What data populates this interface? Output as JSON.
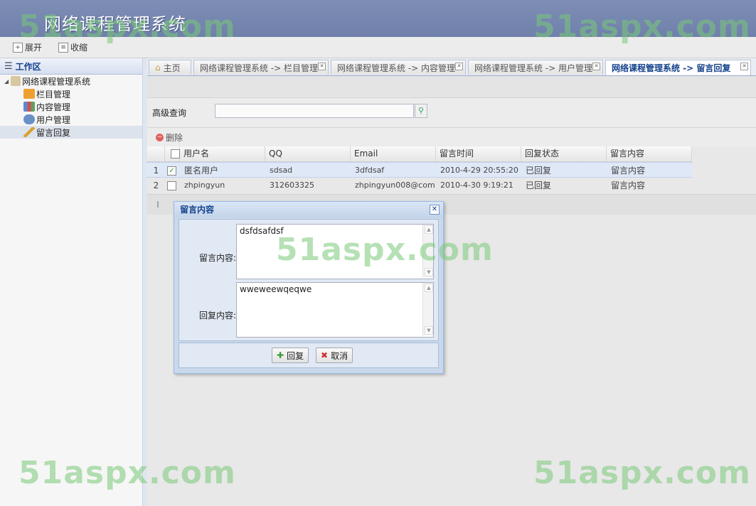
{
  "app": {
    "title": "网络课程管理系统"
  },
  "toolbar": {
    "expand_label": "展开",
    "collapse_label": "收缩"
  },
  "sidebar": {
    "header": "工作区",
    "root": "网络课程管理系统",
    "items": [
      {
        "label": "栏目管理",
        "icon": "rss-icon"
      },
      {
        "label": "内容管理",
        "icon": "chart-icon"
      },
      {
        "label": "用户管理",
        "icon": "user-icon"
      },
      {
        "label": "留言回复",
        "icon": "pencil-icon"
      }
    ]
  },
  "tabs": [
    {
      "label": "主页"
    },
    {
      "label": "网络课程管理系统 -> 栏目管理"
    },
    {
      "label": "网络课程管理系统 -> 内容管理"
    },
    {
      "label": "网络课程管理系统 -> 用户管理"
    },
    {
      "label": "网络课程管理系统 -> 留言回复"
    }
  ],
  "search": {
    "label": "高级查询",
    "value": ""
  },
  "actions": {
    "delete_label": "删除"
  },
  "grid": {
    "columns": [
      "用户名",
      "QQ",
      "Email",
      "留言时间",
      "回复状态",
      "留言内容"
    ],
    "rows": [
      {
        "num": "1",
        "checked": true,
        "user": "匿名用户",
        "qq": "sdsad",
        "email": "3dfdsaf",
        "time": "2010-4-29 20:55:20",
        "status": "已回复",
        "content": "留言内容"
      },
      {
        "num": "2",
        "checked": false,
        "user": "zhpingyun",
        "qq": "312603325",
        "email": "zhpingyun008@com",
        "time": "2010-4-30 9:19:21",
        "status": "已回复",
        "content": "留言内容"
      }
    ]
  },
  "dialog": {
    "title": "留言内容",
    "message_label": "留言内容:",
    "message_value": "dsfdsafdsf",
    "reply_label": "回复内容:",
    "reply_value": "wweweewqeqwe",
    "reply_button": "回复",
    "cancel_button": "取消"
  },
  "watermark": "51aspx.com"
}
